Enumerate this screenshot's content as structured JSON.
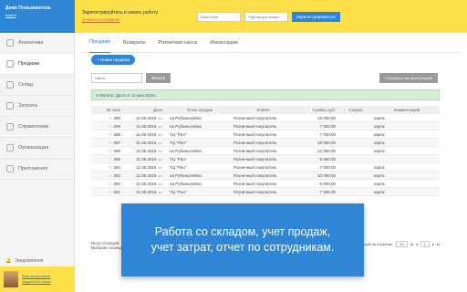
{
  "user": {
    "name": "Демо Пользователь",
    "logout": "Выйти"
  },
  "promo": {
    "text": "Зарегистрируйтесь и начать работу",
    "sub": "(1 месяц в подарок)"
  },
  "register": {
    "email_placeholder": "Ваш Email",
    "password_placeholder": "Пароль для входа",
    "button": "Зарегистрироваться"
  },
  "sidebar": {
    "items": [
      {
        "label": "Аналитика"
      },
      {
        "label": "Продажи"
      },
      {
        "label": "Склад"
      },
      {
        "label": "Затраты"
      },
      {
        "label": "Справочники"
      },
      {
        "label": "Организация"
      },
      {
        "label": "Приложения"
      }
    ],
    "notifications": "Уведомления",
    "consultant_label": "Ваш консультант",
    "consultant_name": "Андрей Мельнов"
  },
  "tabs": [
    "Продажи",
    "Возвраты",
    "Розничная касса",
    "Инкассации"
  ],
  "toolbar": {
    "new_sale": "Новая продажа",
    "search_placeholder": "Найти",
    "filter": "Фильтр",
    "save_filter": "Сохранить как фин (Новый)"
  },
  "filter_info": "Х Фильтр: Дата от 11 мая 2016 г.",
  "table": {
    "headers": [
      "№ чека",
      "Дата",
      "Точка продаж",
      "Клиент",
      "Сумма, руб.",
      "Скидка",
      "Комментарий"
    ],
    "rows": [
      {
        "num": "300",
        "date": "11.05.2016",
        "point": "на Рубинштейна",
        "client": "Розничный покупатель",
        "sum": "15 000.00",
        "discount": "",
        "comment": "карта"
      },
      {
        "num": "299",
        "date": "11.05.2016",
        "point": "на Рубинштейна",
        "client": "Розничный покупатель",
        "sum": "7 000.00",
        "discount": "",
        "comment": "карта"
      },
      {
        "num": "298",
        "date": "11.05.2016",
        "point": "ТЦ \"Рио\"",
        "client": "Розничный покупатель",
        "sum": "7 000.00",
        "discount": "",
        "comment": "карта"
      },
      {
        "num": "297",
        "date": "11.05.2016",
        "point": "ТЦ \"Рио\"",
        "client": "Розничный покупатель",
        "sum": "15 000.00",
        "discount": "",
        "comment": "карта"
      },
      {
        "num": "296",
        "date": "11.05.2016",
        "point": "на Рубинштейна",
        "client": "Розничный покупатель",
        "sum": "12 000.00",
        "discount": "",
        "comment": "карта"
      },
      {
        "num": "295",
        "date": "11.05.2016",
        "point": "ТЦ \"Рио\"",
        "client": "Розничный покупатель",
        "sum": "5 000.00",
        "discount": "",
        "comment": ""
      },
      {
        "num": "294",
        "date": "11.05.2016",
        "point": "ТЦ \"Рио\"",
        "client": "Розничный покупатель",
        "sum": "7 000.00",
        "discount": "",
        "comment": "карта"
      },
      {
        "num": "293",
        "date": "11.05.2016",
        "point": "на Рубинштейна",
        "client": "Розничный покупатель",
        "sum": "10 000.00",
        "discount": "",
        "comment": "карта"
      },
      {
        "num": "292",
        "date": "11.05.2016",
        "point": "на Рубинштейна",
        "client": "Розничный покупатель",
        "sum": "5 000.00",
        "discount": "",
        "comment": "карта"
      },
      {
        "num": "291",
        "date": "11.05.2016",
        "point": "ТЦ \"Рио\"",
        "client": "Розничный покупатель",
        "sum": "7 000.00",
        "discount": "",
        "comment": "карта"
      }
    ],
    "time": "чат"
  },
  "footer": {
    "total": "Всего позиций: 10",
    "selected": "Выбрано позиций: 0",
    "per_page_label": "Позиций на странице:",
    "per_page": "10",
    "page": "1",
    "stub": "Ити"
  },
  "banner": {
    "line1": "Работа со складом, учет продаж,",
    "line2": "учет затрат, отчет по сотрудникам."
  }
}
